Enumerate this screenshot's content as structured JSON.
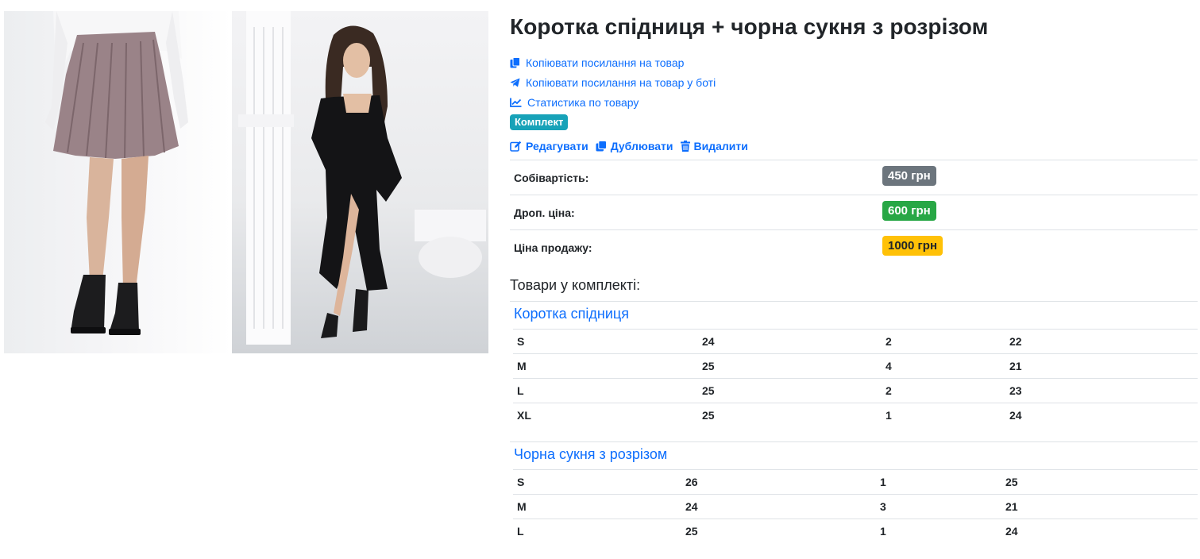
{
  "product": {
    "title": "Коротка спідниця + чорна сукня з розрізом",
    "links": [
      {
        "label": "Копіювати посилання на товар",
        "icon": "copy-icon"
      },
      {
        "label": "Копіювати посилання на товар у боті",
        "icon": "telegram-icon"
      },
      {
        "label": "Статистика по товару",
        "icon": "chart-line-icon"
      }
    ],
    "type_badge": "Комплект",
    "actions": {
      "edit": "Редагувати",
      "duplicate": "Дублювати",
      "delete": "Видалити"
    },
    "prices": [
      {
        "label": "Собівартість:",
        "value": "450 грн",
        "color": "#6c757d",
        "text_color": "#ffffff"
      },
      {
        "label": "Дроп. ціна:",
        "value": "600 грн",
        "color": "#28a745",
        "text_color": "#ffffff"
      },
      {
        "label": "Ціна продажу:",
        "value": "1000 грн",
        "color": "#ffc107",
        "text_color": "#212529"
      }
    ]
  },
  "kit": {
    "heading": "Товари у комплекті:",
    "items": [
      {
        "name": "Коротка спідниця",
        "rows": [
          [
            "S",
            "24",
            "2",
            "22"
          ],
          [
            "M",
            "25",
            "4",
            "21"
          ],
          [
            "L",
            "25",
            "2",
            "23"
          ],
          [
            "XL",
            "25",
            "1",
            "24"
          ]
        ]
      },
      {
        "name": "Чорна сукня з розрізом",
        "rows": [
          [
            "S",
            "26",
            "1",
            "25"
          ],
          [
            "M",
            "24",
            "3",
            "21"
          ],
          [
            "L",
            "25",
            "1",
            "24"
          ]
        ]
      }
    ]
  },
  "colors": {
    "link": "#0d6efd",
    "type_badge": "#17a2b8"
  }
}
